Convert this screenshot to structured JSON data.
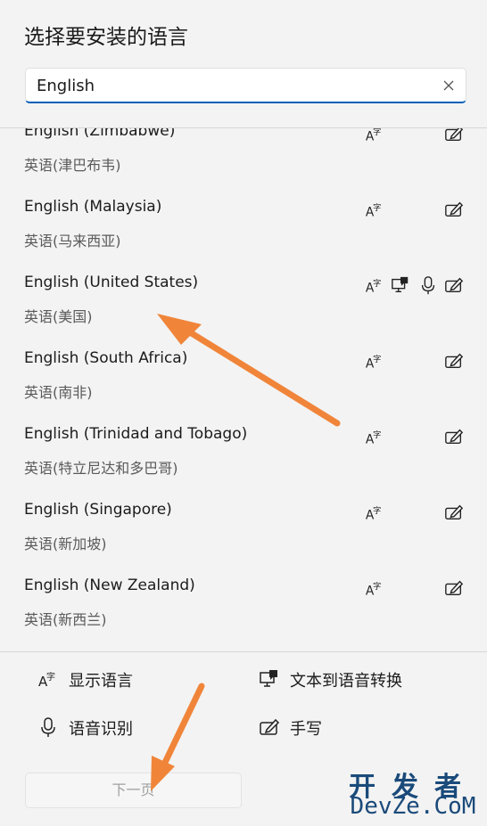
{
  "dialog": {
    "title": "选择要安装的语言"
  },
  "search": {
    "value": "English"
  },
  "languages": [
    {
      "name": "English (Zimbabwe)",
      "native": "英语(津巴布韦)",
      "features": [
        "display",
        "handwriting"
      ]
    },
    {
      "name": "English (Malaysia)",
      "native": "英语(马来西亚)",
      "features": [
        "display",
        "handwriting"
      ]
    },
    {
      "name": "English (United States)",
      "native": "英语(美国)",
      "features": [
        "display",
        "tts",
        "speech",
        "handwriting"
      ]
    },
    {
      "name": "English (South Africa)",
      "native": "英语(南非)",
      "features": [
        "display",
        "handwriting"
      ]
    },
    {
      "name": "English (Trinidad and Tobago)",
      "native": "英语(特立尼达和多巴哥)",
      "features": [
        "display",
        "handwriting"
      ]
    },
    {
      "name": "English (Singapore)",
      "native": "英语(新加坡)",
      "features": [
        "display",
        "handwriting"
      ]
    },
    {
      "name": "English (New Zealand)",
      "native": "英语(新西兰)",
      "features": [
        "display",
        "handwriting"
      ]
    }
  ],
  "legend": {
    "display_language": "显示语言",
    "text_to_speech": "文本到语音转换",
    "speech_recognition": "语音识别",
    "handwriting": "手写"
  },
  "footer": {
    "next_label": "下一页"
  },
  "watermark": {
    "top": "开发者",
    "bottom": "DevZe.CoM"
  },
  "colors": {
    "accent": "#005fb8",
    "arrow": "#f0853a",
    "background": "#f3f3f3"
  }
}
